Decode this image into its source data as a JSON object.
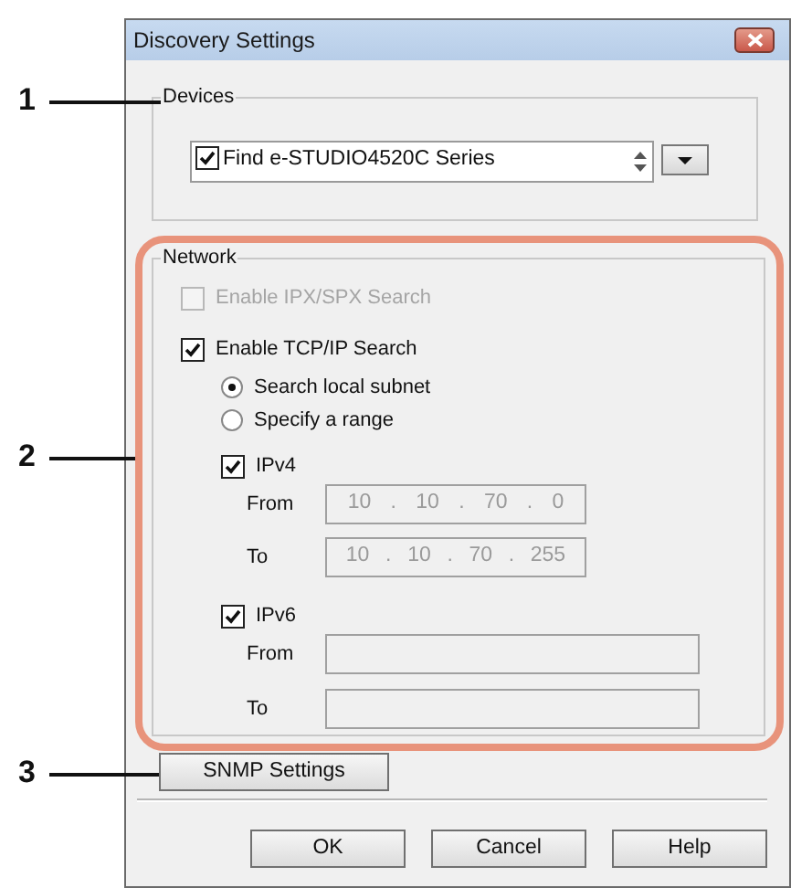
{
  "callouts": [
    {
      "label": "1"
    },
    {
      "label": "2"
    },
    {
      "label": "3"
    }
  ],
  "window": {
    "title": "Discovery Settings"
  },
  "devices": {
    "legend": "Devices",
    "items": [
      {
        "label": "Find e-STUDIO4520C Series",
        "checked": true
      }
    ]
  },
  "network": {
    "legend": "Network",
    "highlighted": true,
    "options": [
      {
        "label": "Enable IPX/SPX Search",
        "checked": false,
        "disabled": true
      },
      {
        "label": "Enable TCP/IP Search",
        "checked": true,
        "disabled": false
      }
    ],
    "scope": [
      {
        "label": "Search local subnet",
        "selected": true
      },
      {
        "label": "Specify a range",
        "selected": false
      }
    ],
    "ipv4": {
      "label": "IPv4",
      "checked": true,
      "separator": ".",
      "from": {
        "label": "From",
        "octets": [
          "10",
          "10",
          "70",
          "0"
        ]
      },
      "to": {
        "label": "To",
        "octets": [
          "10",
          "10",
          "70",
          "255"
        ]
      }
    },
    "ipv6": {
      "label": "IPv6",
      "checked": true,
      "from": {
        "label": "From"
      },
      "to": {
        "label": "To"
      }
    }
  },
  "snmp_button": "SNMP Settings",
  "buttons": [
    "OK",
    "Cancel",
    "Help"
  ]
}
